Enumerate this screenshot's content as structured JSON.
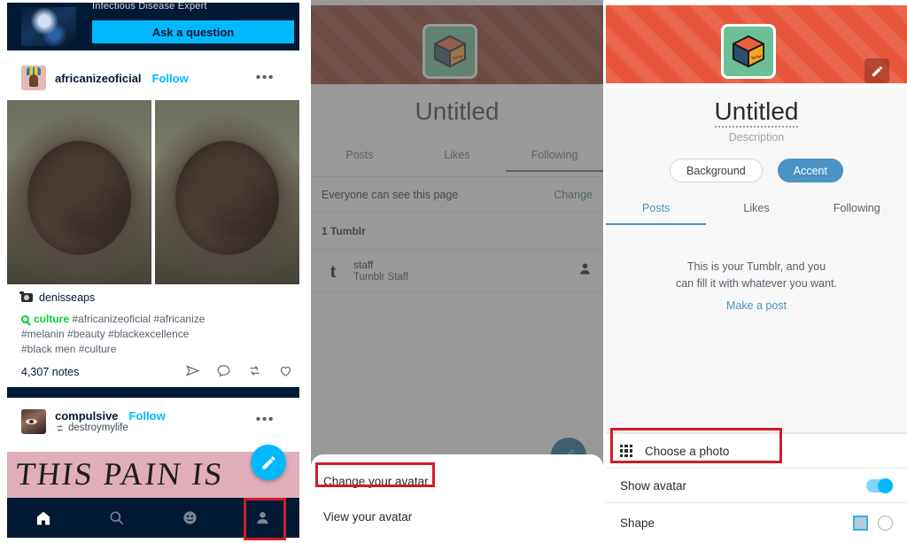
{
  "panels": {
    "feed": {
      "promo": {
        "title": "Infectious Disease Expert",
        "button_label": "Ask a question"
      },
      "post1": {
        "username": "africanizeoficial",
        "follow_label": "Follow",
        "more_label": "•••",
        "source_blog": "denisseaps",
        "search_tag": "culture",
        "tags": "#africanizeoficial  #africanize\n#melanin  #beauty  #blackexcellence\n#black men  #culture",
        "tags_line1": "#africanizeoficial  #africanize",
        "tags_line2": "#melanin  #beauty  #blackexcellence",
        "tags_line3": "#black men  #culture",
        "notes": "4,307 notes"
      },
      "post2": {
        "username": "compulsive",
        "follow_label": "Follow",
        "reblog_from": "destroymylife",
        "more_label": "•••",
        "image_text": "THIS  PAIN  IS"
      },
      "fab": "compose-pencil",
      "tabs": [
        {
          "name": "home",
          "icon": "home-icon",
          "active": true
        },
        {
          "name": "search",
          "icon": "search-icon",
          "active": false
        },
        {
          "name": "activity",
          "icon": "smiley-icon",
          "active": false
        },
        {
          "name": "account",
          "icon": "person-icon",
          "active": false
        }
      ],
      "highlight": "account-tab"
    },
    "middle": {
      "blog_title": "Untitled",
      "avatar_icon": "cube-avatar",
      "tabs": [
        {
          "label": "Posts",
          "active": false
        },
        {
          "label": "Likes",
          "active": false
        },
        {
          "label": "Following",
          "active": true
        }
      ],
      "visibility_text": "Everyone can see this page",
      "visibility_action": "Change",
      "count_label": "1 Tumblr",
      "following": [
        {
          "avatar": "tumblr-t-icon",
          "name": "staff",
          "subtitle": "Tumblr Staff",
          "trailing_icon": "person-icon"
        }
      ],
      "sheet": {
        "items": [
          {
            "label": "Change your avatar",
            "highlighted": true
          },
          {
            "label": "View your avatar",
            "highlighted": false
          }
        ]
      },
      "fab": "compose-pencil"
    },
    "right": {
      "blog_title": "Untitled",
      "description_placeholder": "Description",
      "avatar_icon": "cube-avatar",
      "edit_banner_icon": "pencil-icon",
      "pills": [
        {
          "label": "Background",
          "style": "outline"
        },
        {
          "label": "Accent",
          "style": "filled"
        }
      ],
      "tabs": [
        {
          "label": "Posts",
          "active": true
        },
        {
          "label": "Likes",
          "active": false
        },
        {
          "label": "Following",
          "active": false
        }
      ],
      "empty_line1": "This is your Tumblr, and you",
      "empty_line2": "can fill it with whatever you want.",
      "make_post_label": "Make a post",
      "options": [
        {
          "icon": "grid-icon",
          "label": "Choose a photo",
          "control": "none",
          "highlighted": true
        },
        {
          "icon": "none",
          "label": "Show avatar",
          "control": "toggle-on",
          "highlighted": false
        },
        {
          "icon": "none",
          "label": "Shape",
          "control": "shape-picker",
          "highlighted": false
        }
      ],
      "shape_selected": "square"
    }
  },
  "colors": {
    "tumblr_navy": "#001935",
    "tumblr_blue": "#00b8ff",
    "highlight_red": "#d01c2b",
    "accent_blue": "#4a93c4",
    "banner_orange": "#e6563a",
    "banner_orange_dim": "#8c3422",
    "avatar_green": "#6dbf96",
    "tag_green": "#00cf35"
  }
}
